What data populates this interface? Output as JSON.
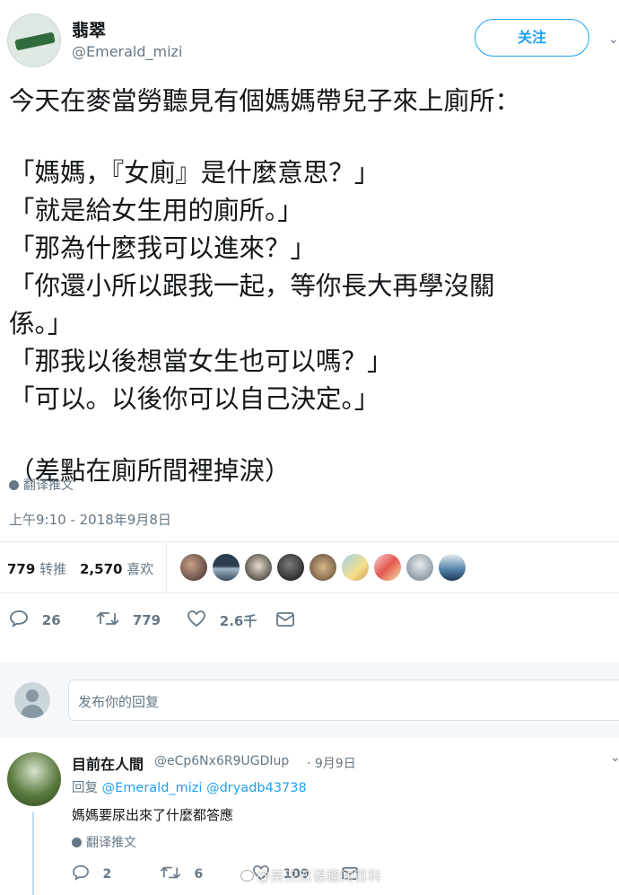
{
  "tweet": {
    "author_name": "翡翠",
    "author_handle": "@Emerald_mizi",
    "follow_label": "关注",
    "lines": [
      "今天在麥當勞聽見有個媽媽帶兒子來上廁所：",
      "「媽媽，『女廁』是什麼意思？」",
      "「就是給女生用的廁所。」",
      "「那為什麼我可以進來？」",
      "「你還小所以跟我一起，等你長大再學沒關",
      "係。」",
      "「那我以後想當女生也可以嗎？」",
      "「可以。以後你可以自己決定。」",
      "（差點在廁所間裡掉淚）"
    ],
    "translate_label": "翻译推文",
    "timestamp": "上午9:10 - 2018年9月8日",
    "retweets_count": "779",
    "retweets_label": "转推",
    "likes_count": "2,570",
    "likes_label": "喜欢",
    "actions": {
      "reply": "26",
      "retweet": "779",
      "like": "2.6千"
    }
  },
  "reply_box": {
    "placeholder": "发布你的回复"
  },
  "reply": {
    "author_name": "目前在人間",
    "author_handle": "@eCp6Nx6R9UGDIup",
    "date": "· 9月9日",
    "replying_prefix": "回复",
    "mention1": "@Emerald_mizi",
    "mention2": "@dryadb43738",
    "text": "媽媽要尿出來了什麼都答應",
    "translate_label": "翻译推文",
    "actions": {
      "reply": "2",
      "retweet": "6",
      "like": "109"
    }
  },
  "watermark": "@英汉双语趣闻百科",
  "colors": {
    "accent": "#1da1f2",
    "muted": "#657786",
    "divider": "#e6ecf0"
  }
}
